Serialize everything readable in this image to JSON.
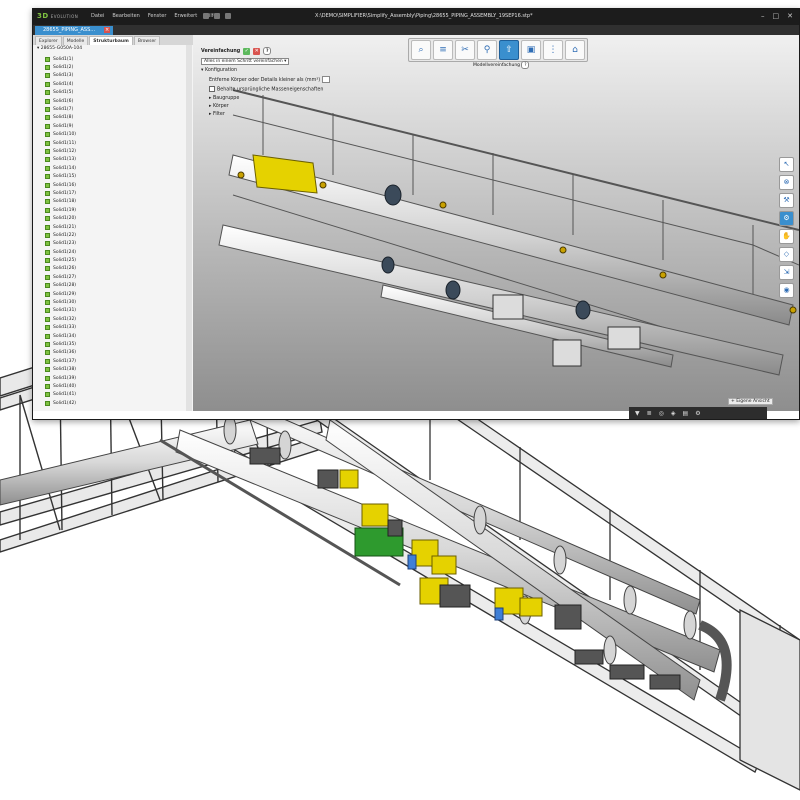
{
  "app": {
    "logo_main": "3D",
    "logo_sub": "EVOLUTION",
    "menu": [
      "Datei",
      "Bearbeiten",
      "Fenster",
      "Erweitert",
      "Hilfe"
    ],
    "file_path": "X:\\DEMO\\SIMPLIFIER\\Simplify_Assembly\\Piping\\28655_PIPING_ASSEMBLY_19SEP16.stp*",
    "document_tab": "28655_PIPING_ASS...",
    "panel_tabs": [
      "Explorer",
      "Modelle",
      "Strukturbaum",
      "Browser"
    ],
    "active_panel_tab": "Strukturbaum"
  },
  "tree": {
    "root": "28655-G050A-104",
    "items": [
      "Solid1(1)",
      "Solid1(2)",
      "Solid1(3)",
      "Solid1(4)",
      "Solid1(5)",
      "Solid1(6)",
      "Solid1(7)",
      "Solid1(8)",
      "Solid1(9)",
      "Solid1(10)",
      "Solid1(11)",
      "Solid1(12)",
      "Solid1(13)",
      "Solid1(14)",
      "Solid1(15)",
      "Solid1(16)",
      "Solid1(17)",
      "Solid1(18)",
      "Solid1(19)",
      "Solid1(20)",
      "Solid1(21)",
      "Solid1(22)",
      "Solid1(23)",
      "Solid1(24)",
      "Solid1(25)",
      "Solid1(26)",
      "Solid1(27)",
      "Solid1(28)",
      "Solid1(29)",
      "Solid1(30)",
      "Solid1(31)",
      "Solid1(32)",
      "Solid1(33)",
      "Solid1(34)",
      "Solid1(35)",
      "Solid1(36)",
      "Solid1(37)",
      "Solid1(38)",
      "Solid1(39)",
      "Solid1(40)",
      "Solid1(41)",
      "Solid1(42)"
    ]
  },
  "simplification": {
    "title": "Vereinfachung",
    "mode": "Alles in einem Schritt vereinfachen",
    "config_label": "Konfiguration",
    "remove_label": "Entferne Körper oder Details kleiner als (mm³)",
    "keep_label": "Behalte ursprüngliche Masseneigenschaften",
    "sections": [
      "Baugruppe",
      "Körper",
      "Filter"
    ]
  },
  "ribbon": {
    "active_label": "Modellvereinfachung"
  },
  "footer": {
    "view_label": "Eigene Ansicht"
  },
  "colors": {
    "tree_icon": "#7fc241",
    "accent": "#3a8fce",
    "highlight_part": "#e5d200",
    "green_part": "#2e9a2e"
  }
}
